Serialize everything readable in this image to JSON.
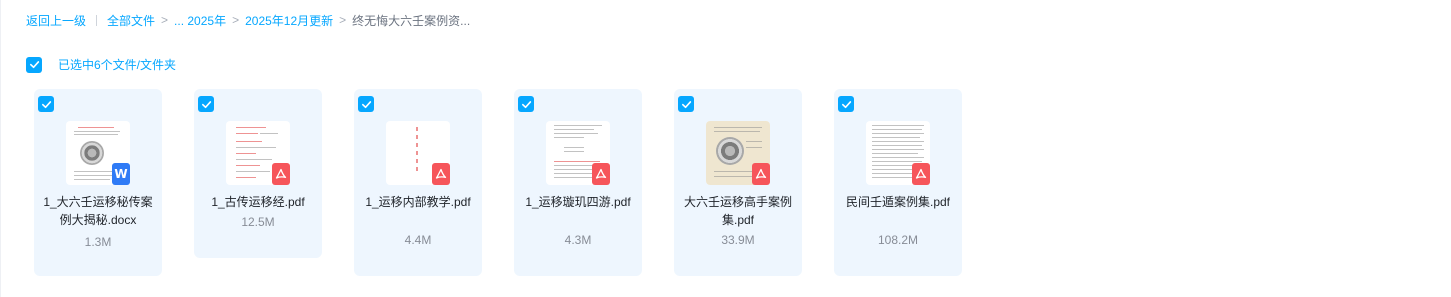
{
  "breadcrumb": {
    "back": "返回上一级",
    "items": [
      "全部文件",
      "... 2025年",
      "2025年12月更新"
    ],
    "current": "终无悔大六壬案例资...",
    "separator": ">"
  },
  "selection": {
    "text": "已选中6个文件/文件夹"
  },
  "colors": {
    "accent": "#06a7ff",
    "card_bg": "#eef6fe",
    "pdf_badge": "#f6555a",
    "word_badge": "#2f7bf6"
  },
  "files": [
    {
      "name": "1_大六壬运移秘传案例大揭秘.docx",
      "size": "1.3M",
      "type": "word",
      "type_icon": "word-file-icon",
      "badge": "W"
    },
    {
      "name": "1_古传运移经.pdf",
      "size": "12.5M",
      "type": "pdf",
      "type_icon": "pdf-file-icon"
    },
    {
      "name": "1_运移内部教学.pdf",
      "size": "4.4M",
      "type": "pdf",
      "type_icon": "pdf-file-icon"
    },
    {
      "name": "1_运移璇玑四游.pdf",
      "size": "4.3M",
      "type": "pdf",
      "type_icon": "pdf-file-icon"
    },
    {
      "name": "大六壬运移高手案例集.pdf",
      "size": "33.9M",
      "type": "pdf",
      "type_icon": "pdf-file-icon"
    },
    {
      "name": "民间壬遁案例集.pdf",
      "size": "108.2M",
      "type": "pdf",
      "type_icon": "pdf-file-icon"
    }
  ]
}
